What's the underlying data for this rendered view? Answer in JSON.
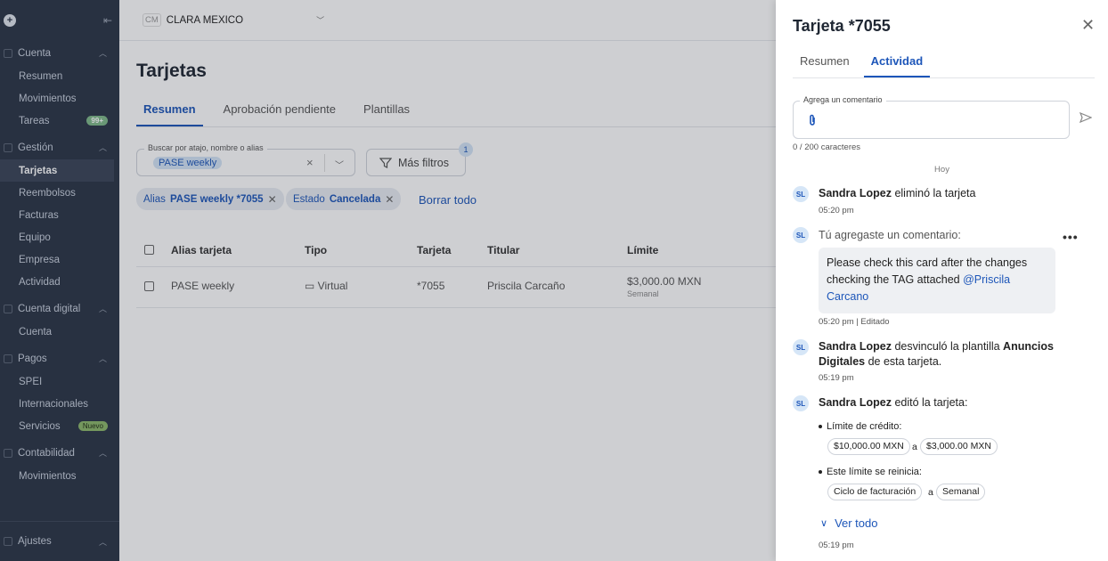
{
  "sidebar": {
    "top": {
      "logo_icon": "plus-circle-icon",
      "collapse_icon": "collapse-sidebar-icon"
    },
    "groups": [
      {
        "label": "Cuenta",
        "items": [
          {
            "label": "Resumen"
          },
          {
            "label": "Movimientos"
          },
          {
            "label": "Tareas",
            "badge": "99+"
          }
        ]
      },
      {
        "label": "Gestión",
        "items": [
          {
            "label": "Tarjetas",
            "active": true
          },
          {
            "label": "Reembolsos"
          },
          {
            "label": "Facturas"
          },
          {
            "label": "Equipo"
          },
          {
            "label": "Empresa"
          },
          {
            "label": "Actividad"
          }
        ]
      },
      {
        "label": "Cuenta digital",
        "items": [
          {
            "label": "Cuenta"
          }
        ]
      },
      {
        "label": "Pagos",
        "items": [
          {
            "label": "SPEI"
          },
          {
            "label": "Internacionales"
          },
          {
            "label": "Servicios",
            "badge": "Nuevo"
          }
        ]
      },
      {
        "label": "Contabilidad",
        "items": [
          {
            "label": "Movimientos"
          }
        ]
      }
    ],
    "footer": {
      "label": "Ajustes"
    }
  },
  "topbar": {
    "company_initials": "CM",
    "company_name": "CLARA MEXICO"
  },
  "main": {
    "title": "Tarjetas",
    "tabs": [
      "Resumen",
      "Aprobación pendiente",
      "Plantillas"
    ],
    "search": {
      "label": "Buscar por atajo, nombre o alias",
      "chip": "PASE weekly"
    },
    "filters_button": {
      "label": "Más filtros",
      "badge": "1"
    },
    "filter_chips": [
      {
        "key": "Alias",
        "value": "PASE weekly *7055"
      },
      {
        "key": "Estado",
        "value": "Cancelada"
      }
    ],
    "clear_all": "Borrar todo",
    "table": {
      "headers": [
        "Alias tarjeta",
        "Tipo",
        "Tarjeta",
        "Titular",
        "Límite"
      ],
      "rows": [
        {
          "alias": "PASE weekly",
          "type": "Virtual",
          "card": "*7055",
          "holder": "Priscila Carcaño",
          "limit": "$3,000.00 MXN",
          "limit_period": "Semanal"
        }
      ]
    }
  },
  "panel": {
    "title": "Tarjeta *7055",
    "tabs": [
      "Resumen",
      "Actividad"
    ],
    "comment": {
      "label": "Agrega un comentario",
      "counter": "0 / 200 caracteres"
    },
    "day_label": "Hoy",
    "events": {
      "e1": {
        "initials": "SL",
        "actor": "Sandra Lopez",
        "text": " eliminó la tarjeta",
        "time": "05:20 pm"
      },
      "e2": {
        "initials": "SL",
        "text": "Tú agregaste un comentario:",
        "comment_text": "Please check this card after the changes checking the TAG attached ",
        "mention": "@Priscila Carcano",
        "time": "05:20 pm | Editado"
      },
      "e3": {
        "initials": "SL",
        "actor": "Sandra Lopez",
        "text1": " desvinculó la plantilla ",
        "template": "Anuncios Digitales",
        "text2": " de esta tarjeta.",
        "time": "05:19 pm"
      },
      "e4": {
        "initials": "SL",
        "actor": "Sandra Lopez",
        "text": " editó la tarjeta:",
        "change1": {
          "label": "Límite de crédito:",
          "from": "$10,000.00 MXN",
          "conj": "a",
          "to": "$3,000.00 MXN"
        },
        "change2": {
          "label": "Este límite se reinicia:",
          "from": "Ciclo de facturación",
          "conj": "a",
          "to": "Semanal"
        },
        "see_all": "Ver todo",
        "time": "05:19 pm"
      }
    }
  }
}
